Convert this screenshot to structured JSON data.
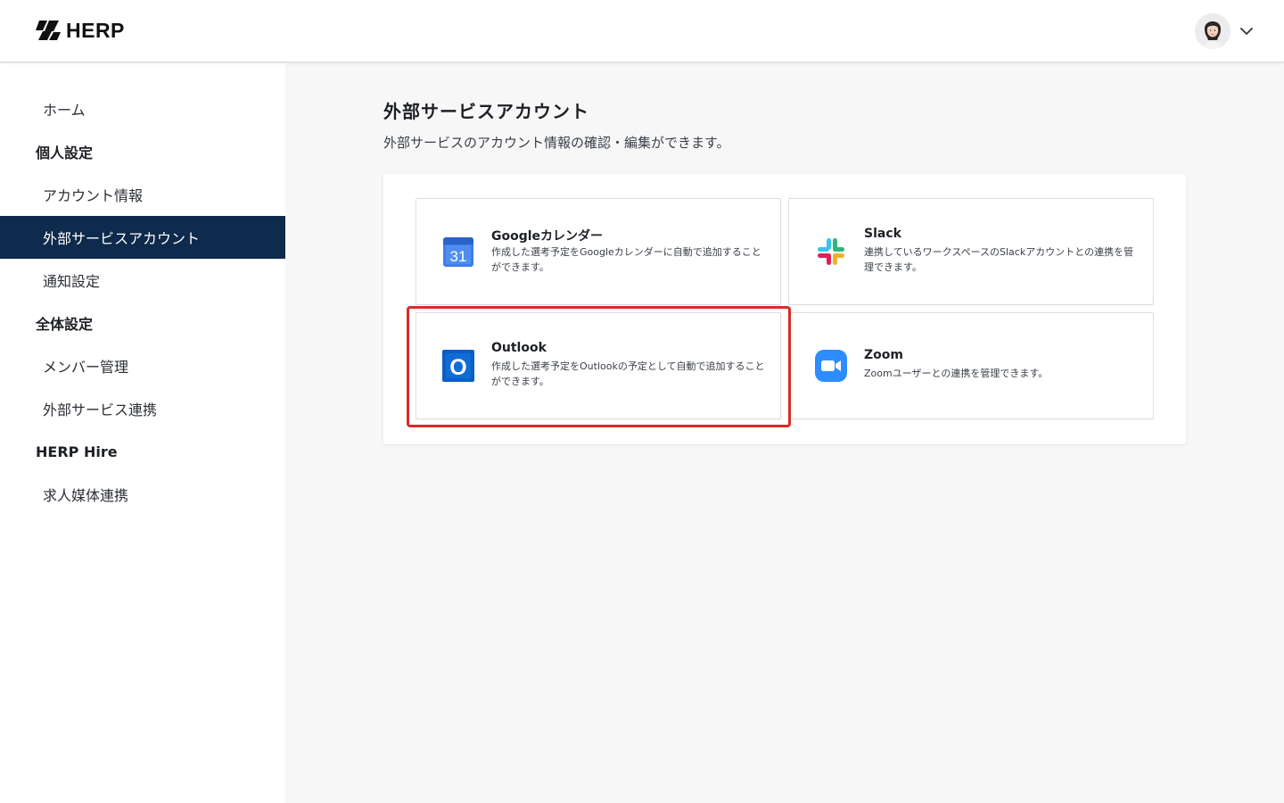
{
  "header": {
    "logo_text": "HERP",
    "user_menu_icon": "chevron-down-icon"
  },
  "sidebar": {
    "items": [
      {
        "label": "ホーム",
        "type": "item"
      },
      {
        "label": "個人設定",
        "type": "group"
      },
      {
        "label": "アカウント情報",
        "type": "item"
      },
      {
        "label": "外部サービスアカウント",
        "type": "item",
        "active": true
      },
      {
        "label": "通知設定",
        "type": "item"
      },
      {
        "label": "全体設定",
        "type": "group"
      },
      {
        "label": "メンバー管理",
        "type": "item"
      },
      {
        "label": "外部サービス連携",
        "type": "item"
      },
      {
        "label": "HERP Hire",
        "type": "group"
      },
      {
        "label": "求人媒体連携",
        "type": "item"
      }
    ]
  },
  "main": {
    "title": "外部サービスアカウント",
    "description": "外部サービスのアカウント情報の確認・編集ができます。",
    "cards": [
      {
        "title": "Googleカレンダー",
        "description": "作成した選考予定をGoogleカレンダーに自動で追加することができます。",
        "icon": "google-calendar-icon",
        "icon_text": "31"
      },
      {
        "title": "Slack",
        "description": "連携しているワークスペースのSlackアカウントとの連携を管理できます。",
        "icon": "slack-icon"
      },
      {
        "title": "Outlook",
        "description": "作成した選考予定をOutlookの予定として自動で追加することができます。",
        "icon": "outlook-icon",
        "icon_text": "O",
        "highlighted": true
      },
      {
        "title": "Zoom",
        "description": "Zoomユーザーとの連携を管理できます。",
        "icon": "zoom-icon"
      }
    ]
  },
  "colors": {
    "sidebar_active_bg": "#0e2a4c",
    "highlight_border": "#d92b2b",
    "page_bg": "#f7f7f8"
  }
}
